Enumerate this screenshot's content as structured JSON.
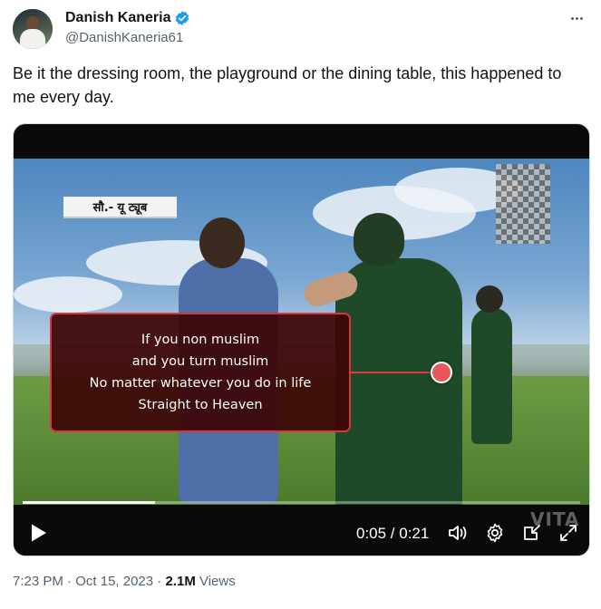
{
  "author": {
    "display_name": "Danish Kaneria",
    "handle": "@DanishKaneria61",
    "verified_icon": "verified-badge-icon",
    "verified_color": "#1d9bf0"
  },
  "more_icon": "more-horizontal-icon",
  "tweet": {
    "text": "Be it the dressing room, the playground or the dining table, this happened to me every day."
  },
  "video": {
    "channel_banner": "सौ.- यू ट्यूब",
    "caption_lines": [
      "If you non muslim",
      "and you turn muslim",
      "No matter whatever you do in life",
      "Straight to Heaven"
    ],
    "progress": 0.238,
    "time": "0:05 / 0:21",
    "watermark": "VITA",
    "controls": {
      "play_icon": "play-icon",
      "volume_icon": "volume-icon",
      "settings_icon": "gear-icon",
      "pip_icon": "picture-in-picture-icon",
      "fullscreen_icon": "fullscreen-icon"
    },
    "accent_color": "#d8363b"
  },
  "meta": {
    "time": "7:23 PM",
    "separator": " · ",
    "date": "Oct 15, 2023",
    "views_count": "2.1M",
    "views_label": " Views"
  }
}
